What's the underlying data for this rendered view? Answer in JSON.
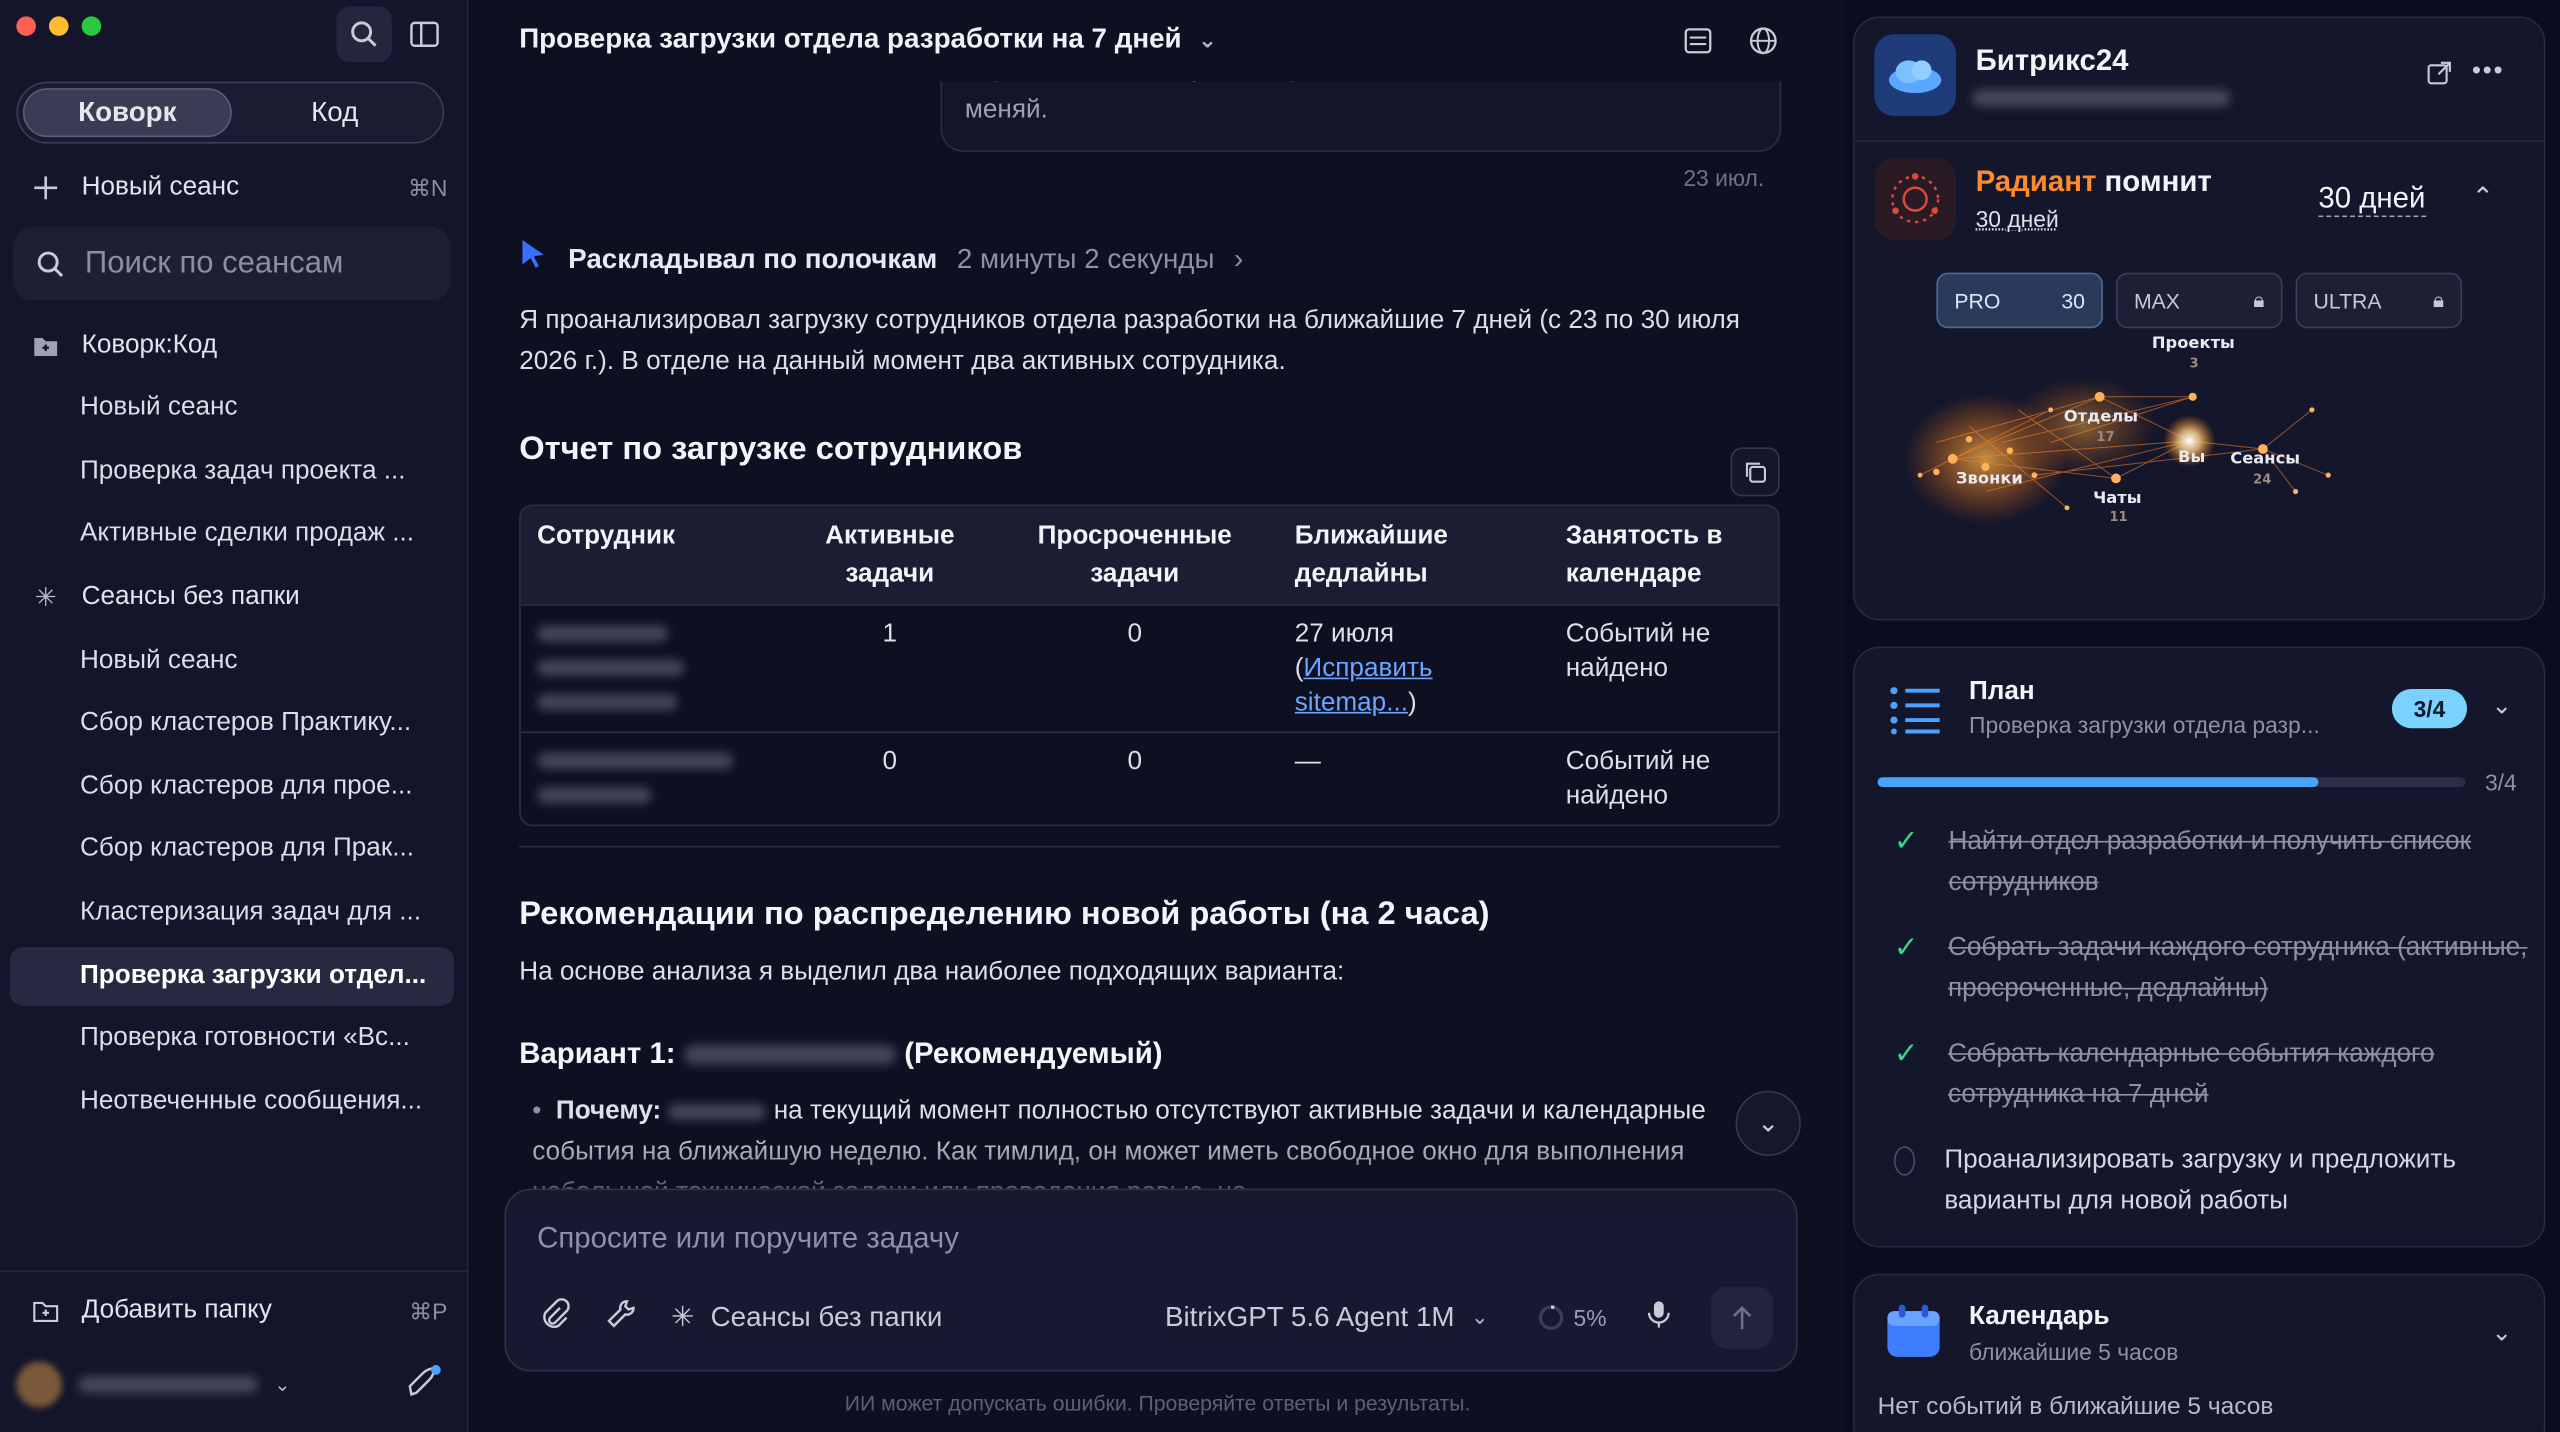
{
  "sidebar": {
    "tabs": [
      "Коворк",
      "Код"
    ],
    "new_session": {
      "label": "Новый сеанс",
      "shortcut": "⌘N"
    },
    "search_placeholder": "Поиск по сеансам",
    "folder": "Коворк:Код",
    "folder_items": [
      "Новый сеанс",
      "Проверка задач проекта ...",
      "Активные сделки продаж ..."
    ],
    "nofolder": "Сеансы без папки",
    "nofolder_items": [
      "Новый сеанс",
      "Сбор кластеров Практику...",
      "Сбор кластеров для прое...",
      "Сбор кластеров для Прак...",
      "Кластеризация задач для ...",
      "Проверка загрузки отдел...",
      "Проверка готовности «Вс...",
      "Неотвеченные сообщения..."
    ],
    "add_folder": {
      "label": "Добавить папку",
      "shortcut": "⌘P"
    }
  },
  "main": {
    "title": "Проверка загрузки отдела разработки на 7 дней",
    "prev_message_tail": [
      "вариантов и обоснуй выбор. Ничего не назначай и не",
      "меняй."
    ],
    "date": "23 июл.",
    "thinking": {
      "label": "Раскладывал по полочкам",
      "duration": "2 минуты 2 секунды"
    },
    "intro": "Я проанализировал загрузку сотрудников отдела разработки на ближайшие 7 дней (с 23 по 30 июля 2026 г.). В отделе на данный момент два активных сотрудника.",
    "report_title": "Отчет по загрузке сотрудников",
    "table": {
      "headers": [
        "Сотрудник",
        "Активные задачи",
        "Просроченные задачи",
        "Ближайшие дедлайны",
        "Занятость в календаре"
      ],
      "rows": [
        {
          "active": "1",
          "overdue": "0",
          "deadline_pre": "27 июля (",
          "deadline_link": "Исправить sitemap...",
          "deadline_post": ")",
          "calendar": "Событий не найдено"
        },
        {
          "active": "0",
          "overdue": "0",
          "deadline_pre": "—",
          "deadline_link": "",
          "deadline_post": "",
          "calendar": "Событий не найдено"
        }
      ]
    },
    "rec_title": "Рекомендации по распределению новой работы (на 2 часа)",
    "rec_intro": "На основе анализа я выделил два наиболее подходящих варианта:",
    "variant_label": "Вариант 1:",
    "variant_suffix": "(Рекомендуемый)",
    "why_label": "Почему:",
    "why_text": "на текущий момент полностью отсутствуют активные задачи и календарные события на ближайшую неделю. Как тимлид, он может иметь свободное окно для выполнения небольшой технической задачи или проведения ревью, не",
    "composer": {
      "placeholder": "Спросите или поручите задачу",
      "folder": "Сеансы без папки",
      "model": "BitrixGPT 5.6 Agent 1M",
      "usage": "5%"
    },
    "disclaimer": "ИИ может допускать ошибки. Проверяйте ответы и результаты."
  },
  "right": {
    "app_name": "Битрикс24",
    "memory": {
      "brand": "Радиант",
      "rest": "помнит",
      "period": "30 дней",
      "period_select": "30 дней"
    },
    "plans": [
      {
        "name": "PRO",
        "value": "30"
      },
      {
        "name": "MAX"
      },
      {
        "name": "ULTRA"
      }
    ],
    "graph_labels": [
      {
        "name": "Проекты",
        "count": "3"
      },
      {
        "name": "Отделы",
        "count": "17"
      },
      {
        "name": "Вы",
        "count": ""
      },
      {
        "name": "Сеансы",
        "count": "24"
      },
      {
        "name": "Звонки",
        "count": ""
      },
      {
        "name": "Чаты",
        "count": "11"
      }
    ],
    "plan": {
      "title": "План",
      "subtitle": "Проверка загрузки отдела разр...",
      "badge": "3/4",
      "progress_text": "3/4",
      "progress": 0.75,
      "items": [
        {
          "text": "Найти отдел разработки и получить список сотрудников",
          "done": true
        },
        {
          "text": "Собрать задачи каждого сотрудника (активные, просроченные, дедлайны)",
          "done": true
        },
        {
          "text": "Собрать календарные события каждого сотрудника на 7 дней",
          "done": true
        },
        {
          "text": "Проанализировать загрузку и предложить варианты для новой работы",
          "done": false
        }
      ]
    },
    "calendar": {
      "title": "Календарь",
      "subtitle": "ближайшие 5 часов",
      "empty": "Нет событий в ближайшие 5 часов"
    }
  },
  "colors": {
    "accent": "#4aa3ff",
    "brand_orange": "#ff8a2a",
    "check": "#3bd486"
  }
}
